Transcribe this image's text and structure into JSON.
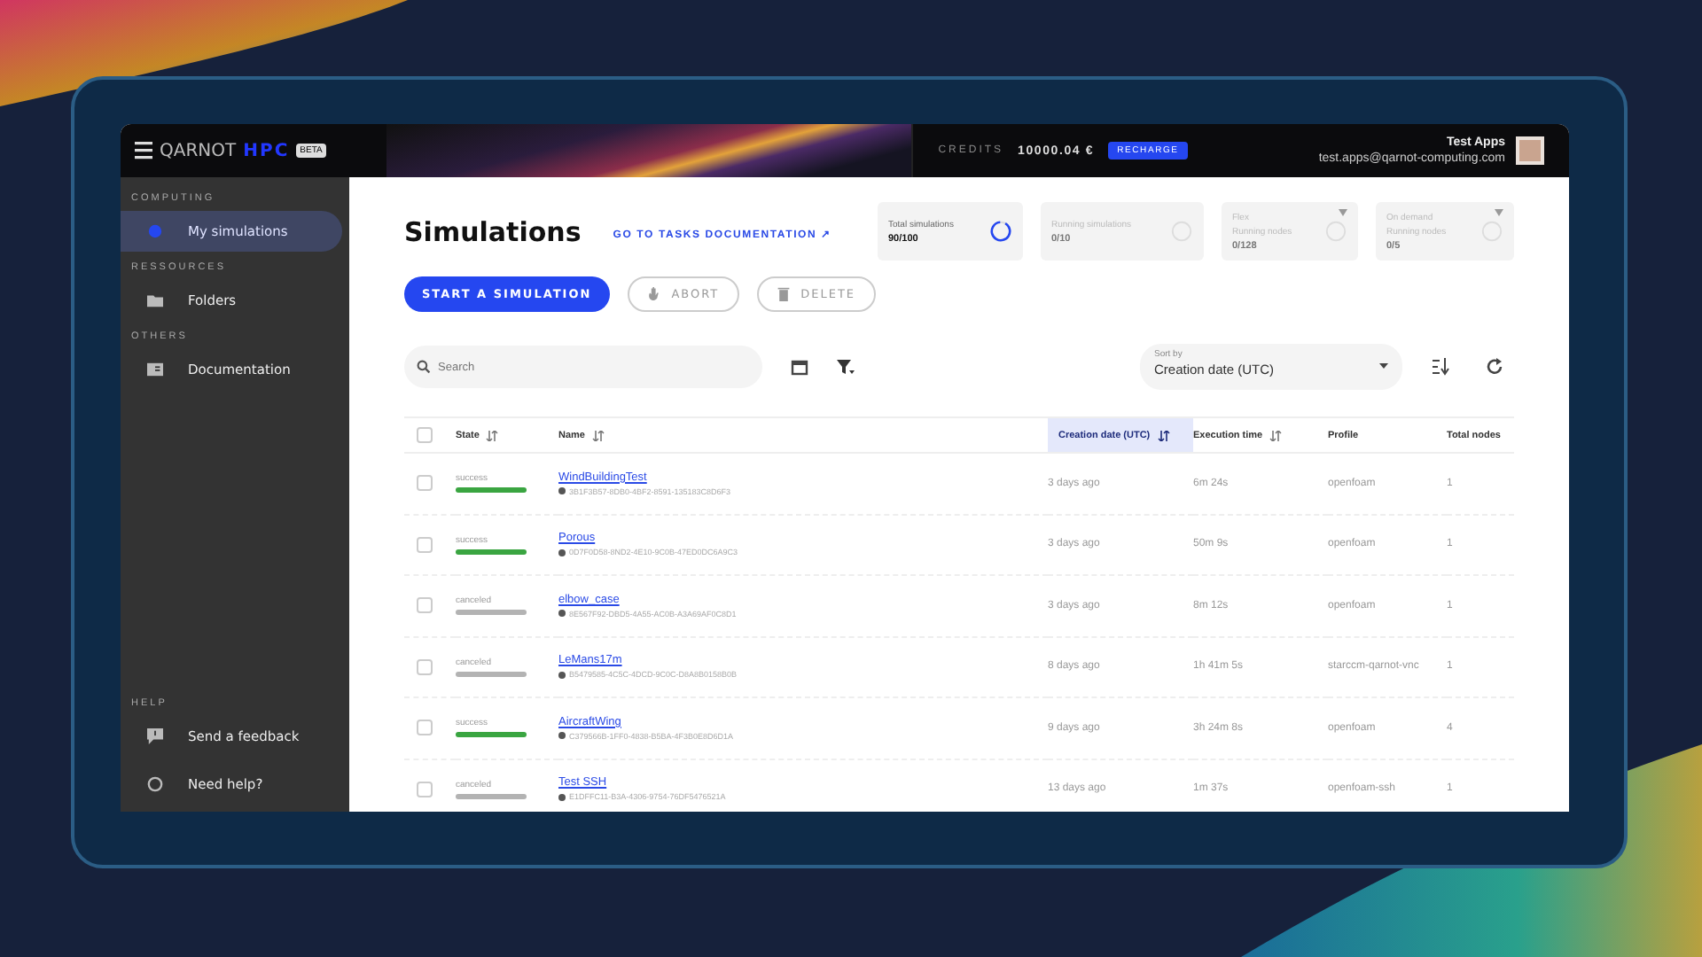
{
  "topbar": {
    "brand": "QARNOT",
    "product": "HPC",
    "badge": "BETA",
    "credits_label": "CREDITS",
    "credits_value": "10000.04 €",
    "recharge": "RECHARGE",
    "user_name": "Test Apps",
    "user_email": "test.apps@qarnot-computing.com"
  },
  "sidebar": {
    "sections": [
      {
        "title": "COMPUTING",
        "items": [
          {
            "label": "My simulations",
            "kind": "dot",
            "selected": true
          }
        ]
      },
      {
        "title": "RESSOURCES",
        "items": [
          {
            "label": "Folders",
            "kind": "folder",
            "selected": false
          }
        ]
      },
      {
        "title": "OTHERS",
        "items": [
          {
            "label": "Documentation",
            "kind": "book",
            "selected": false
          }
        ]
      }
    ],
    "help": {
      "title": "HELP",
      "items": [
        {
          "label": "Send a feedback",
          "kind": "feedback",
          "selected": false
        },
        {
          "label": "Need help?",
          "kind": "help",
          "selected": false
        }
      ]
    }
  },
  "page": {
    "title": "Simulations",
    "doc_link": "GO TO TASKS DOCUMENTATION ↗"
  },
  "stats": [
    {
      "label": "Total simulations",
      "value": "90/100",
      "level": 0.9,
      "disabled": false,
      "dropdown": false
    },
    {
      "label": "Running simulations",
      "value": "0/10",
      "disabled": true,
      "dropdown": false
    },
    {
      "mode": "Flex",
      "label": "Running nodes",
      "value": "0/128",
      "disabled": true,
      "dropdown": true
    },
    {
      "mode": "On demand",
      "label": "Running nodes",
      "value": "0/5",
      "disabled": true,
      "dropdown": true
    }
  ],
  "actions": [
    {
      "label": "START A SIMULATION",
      "kind": "primary"
    },
    {
      "label": "ABORT",
      "kind": "stop"
    },
    {
      "label": "DELETE",
      "kind": "delete"
    }
  ],
  "search": {
    "placeholder": "Search"
  },
  "sort": {
    "label": "Sort by",
    "value": "Creation date (UTC)"
  },
  "table": {
    "select_all": {
      "checked": false
    },
    "columns": [
      {
        "label": "State",
        "sortable": true,
        "selected": false
      },
      {
        "label": "Name",
        "sortable": true,
        "selected": false
      },
      {
        "label": "Creation date (UTC)",
        "sortable": true,
        "selected": true
      },
      {
        "label": "Execution time",
        "sortable": true,
        "selected": false
      },
      {
        "label": "Profile",
        "sortable": false,
        "selected": false
      },
      {
        "label": "Total nodes",
        "sortable": false,
        "selected": false
      }
    ],
    "rows": [
      {
        "checked": false,
        "state": "success",
        "color": "#3aa541",
        "name": "WindBuildingTest",
        "uuid": "3B1F3B57-8DB0-4BF2-8591-135183C8D6F3",
        "created": "3 days ago",
        "execution": "6m 24s",
        "profile": "openfoam",
        "nodes": "1"
      },
      {
        "checked": false,
        "state": "success",
        "color": "#3aa541",
        "name": "Porous",
        "uuid": "0D7F0D58-8ND2-4E10-9C0B-47ED0DC6A9C3",
        "created": "3 days ago",
        "execution": "50m 9s",
        "profile": "openfoam",
        "nodes": "1"
      },
      {
        "checked": false,
        "state": "canceled",
        "color": "#b3b3b3",
        "name": "elbow_case",
        "uuid": "8E567F92-DBD5-4A55-AC0B-A3A69AF0C8D1",
        "created": "3 days ago",
        "execution": "8m 12s",
        "profile": "openfoam",
        "nodes": "1"
      },
      {
        "checked": false,
        "state": "canceled",
        "color": "#b3b3b3",
        "name": "LeMans17m",
        "uuid": "B5479585-4C5C-4DCD-9C0C-D8A8B0158B0B",
        "created": "8 days ago",
        "execution": "1h 41m 5s",
        "profile": "starccm-qarnot-vnc",
        "nodes": "1"
      },
      {
        "checked": false,
        "state": "success",
        "color": "#3aa541",
        "name": "AircraftWing",
        "uuid": "C379566B-1FF0-4838-B5BA-4F3B0E8D6D1A",
        "created": "9 days ago",
        "execution": "3h 24m 8s",
        "profile": "openfoam",
        "nodes": "4"
      },
      {
        "checked": false,
        "state": "canceled",
        "color": "#b3b3b3",
        "name": "Test SSH",
        "uuid": "E1DFFC11-B3A-4306-9754-76DF5476521A",
        "created": "13 days ago",
        "execution": "1m 37s",
        "profile": "openfoam-ssh",
        "nodes": "1"
      }
    ]
  }
}
